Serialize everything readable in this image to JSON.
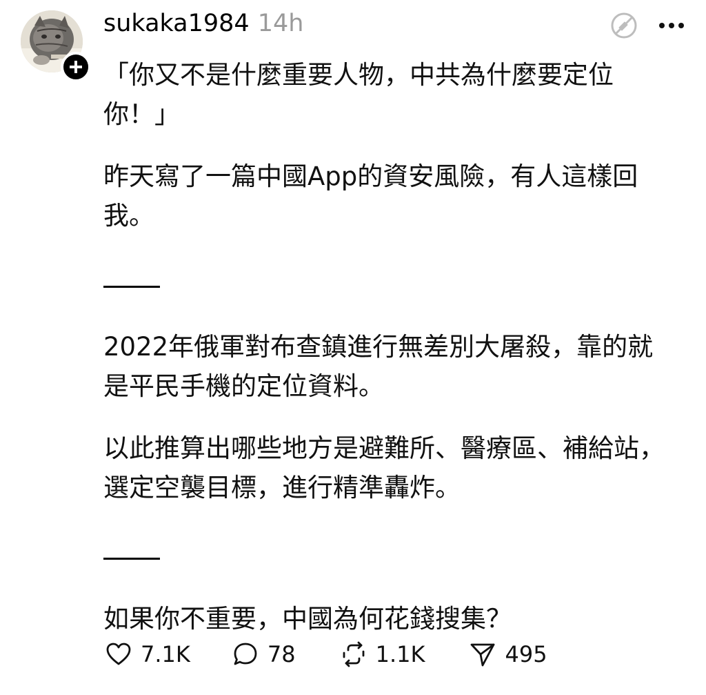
{
  "post": {
    "username": "sukaka1984",
    "timestamp": "14h",
    "paragraphs": [
      "「你又不是什麼重要人物，中共為什麼要定位你！」",
      "昨天寫了一篇中國App的資安風險，有人這樣回我。",
      "2022年俄軍對布查鎮進行無差別大屠殺，靠的就是平民手機的定位資料。",
      "以此推算出哪些地方是避難所、醫療區、補給站，選定空襲目標，進行精準轟炸。",
      "如果你不重要，中國為何花錢搜集？"
    ],
    "actions": {
      "likes": "7.1K",
      "replies": "78",
      "reposts": "1.1K",
      "shares": "495"
    }
  },
  "icons": {
    "follow": "plus-icon",
    "translate": "no-translate-icon",
    "more": "more-horizontal-icon",
    "like": "heart-icon",
    "reply": "comment-bubble-icon",
    "repost": "repost-icon",
    "share": "send-icon"
  },
  "colors": {
    "text": "#000000",
    "muted": "#9a9a9a",
    "icon": "#bdbdbd"
  }
}
